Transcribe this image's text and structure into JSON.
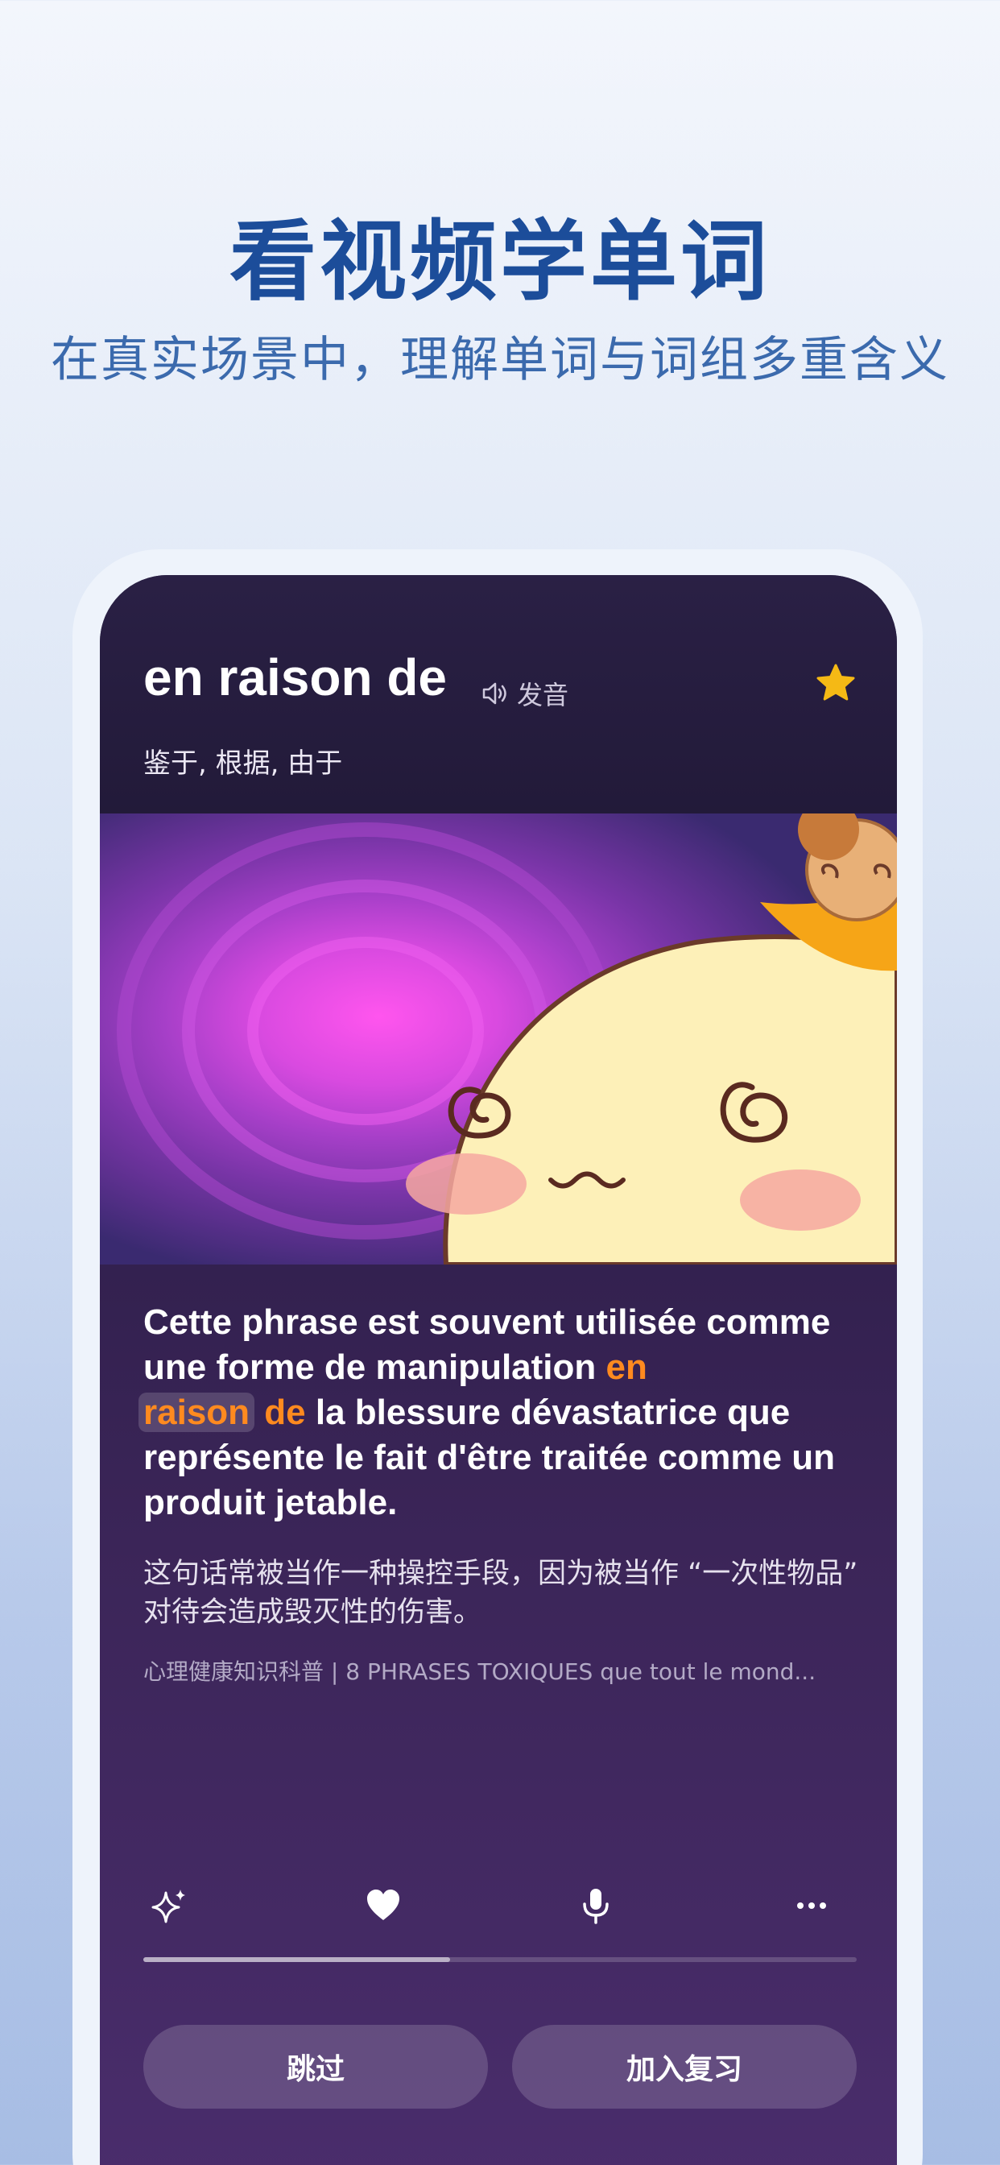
{
  "hero": {
    "title": "看视频学单词",
    "subtitle": "在真实场景中，理解单词与词组多重含义"
  },
  "word_card": {
    "word": "en raison de",
    "pronounce_label": "发音",
    "meaning": "鉴于, 根据, 由于",
    "favorited": true,
    "star_color": "#f5b915"
  },
  "sentence": {
    "fr_before": "Cette phrase est souvent utilisée comme une forme de manipulation ",
    "fr_highlight_1": "en",
    "fr_highlight_2": "raison",
    "fr_highlight_3": "de",
    "fr_after": " la blessure dévastatrice que représente le fait d'être traitée comme un produit jetable.",
    "zh": "这句话常被当作一种操控手段，因为被当作 “一次性物品” 对待会造成毁灭性的伤害。",
    "source": "心理健康知识科普 | 8 PHRASES TOXIQUES que tout le mond..."
  },
  "actions": {
    "icons": [
      "sparkle-icon",
      "heart-icon",
      "microphone-icon",
      "more-icon"
    ]
  },
  "progress": {
    "fraction": 0.43
  },
  "buttons": {
    "skip_label": "跳过",
    "review_label": "加入复习"
  },
  "colors": {
    "title_blue": "#1c4d9a",
    "highlight_orange": "#ff8a1f"
  }
}
